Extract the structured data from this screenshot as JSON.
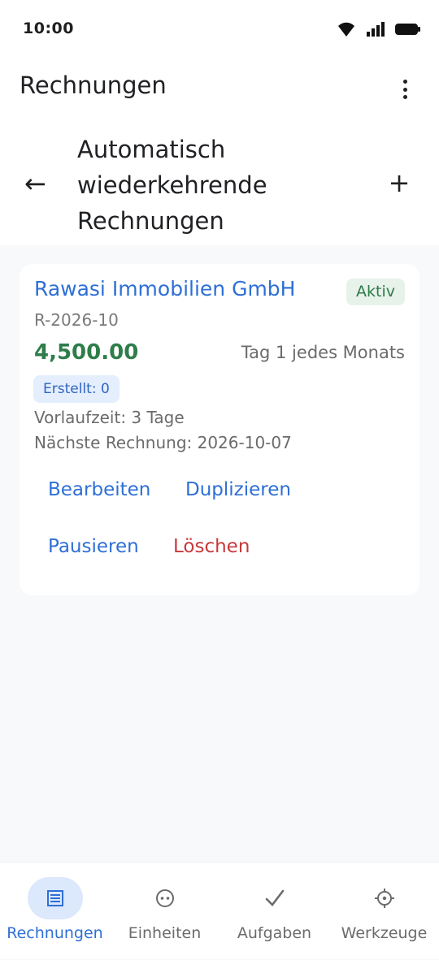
{
  "status_bar": {
    "time": "10:00"
  },
  "app_bar": {
    "title": "Rechnungen"
  },
  "sub_header": {
    "title": "Automatisch wiederkehrende Rechnungen"
  },
  "recurring_invoice": {
    "client": "Rawasi Immobilien GmbH",
    "status": "Aktiv",
    "number": "R-2026-10",
    "amount": "4,500.00",
    "schedule": "Tag 1 jedes Monats",
    "created": "Erstellt: 0",
    "lead_time": "Vorlaufzeit: 3 Tage",
    "next_invoice": "Nächste Rechnung: 2026-10-07",
    "actions": {
      "edit": "Bearbeiten",
      "duplicate": "Duplizieren",
      "pause": "Pausieren",
      "delete": "Löschen"
    }
  },
  "bottom_nav": {
    "items": [
      {
        "label": "Rechnungen",
        "icon": "invoice-list-icon",
        "active": true
      },
      {
        "label": "Einheiten",
        "icon": "units-icon",
        "active": false
      },
      {
        "label": "Aufgaben",
        "icon": "checkmark-icon",
        "active": false
      },
      {
        "label": "Werkzeuge",
        "icon": "tools-gear-icon",
        "active": false
      }
    ]
  },
  "colors": {
    "accent": "#2e6fd6",
    "amount_green": "#2e7d4a",
    "delete_red": "#c9383a",
    "badge_bg": "#e6f2ea",
    "background": "#f7f9fb"
  }
}
